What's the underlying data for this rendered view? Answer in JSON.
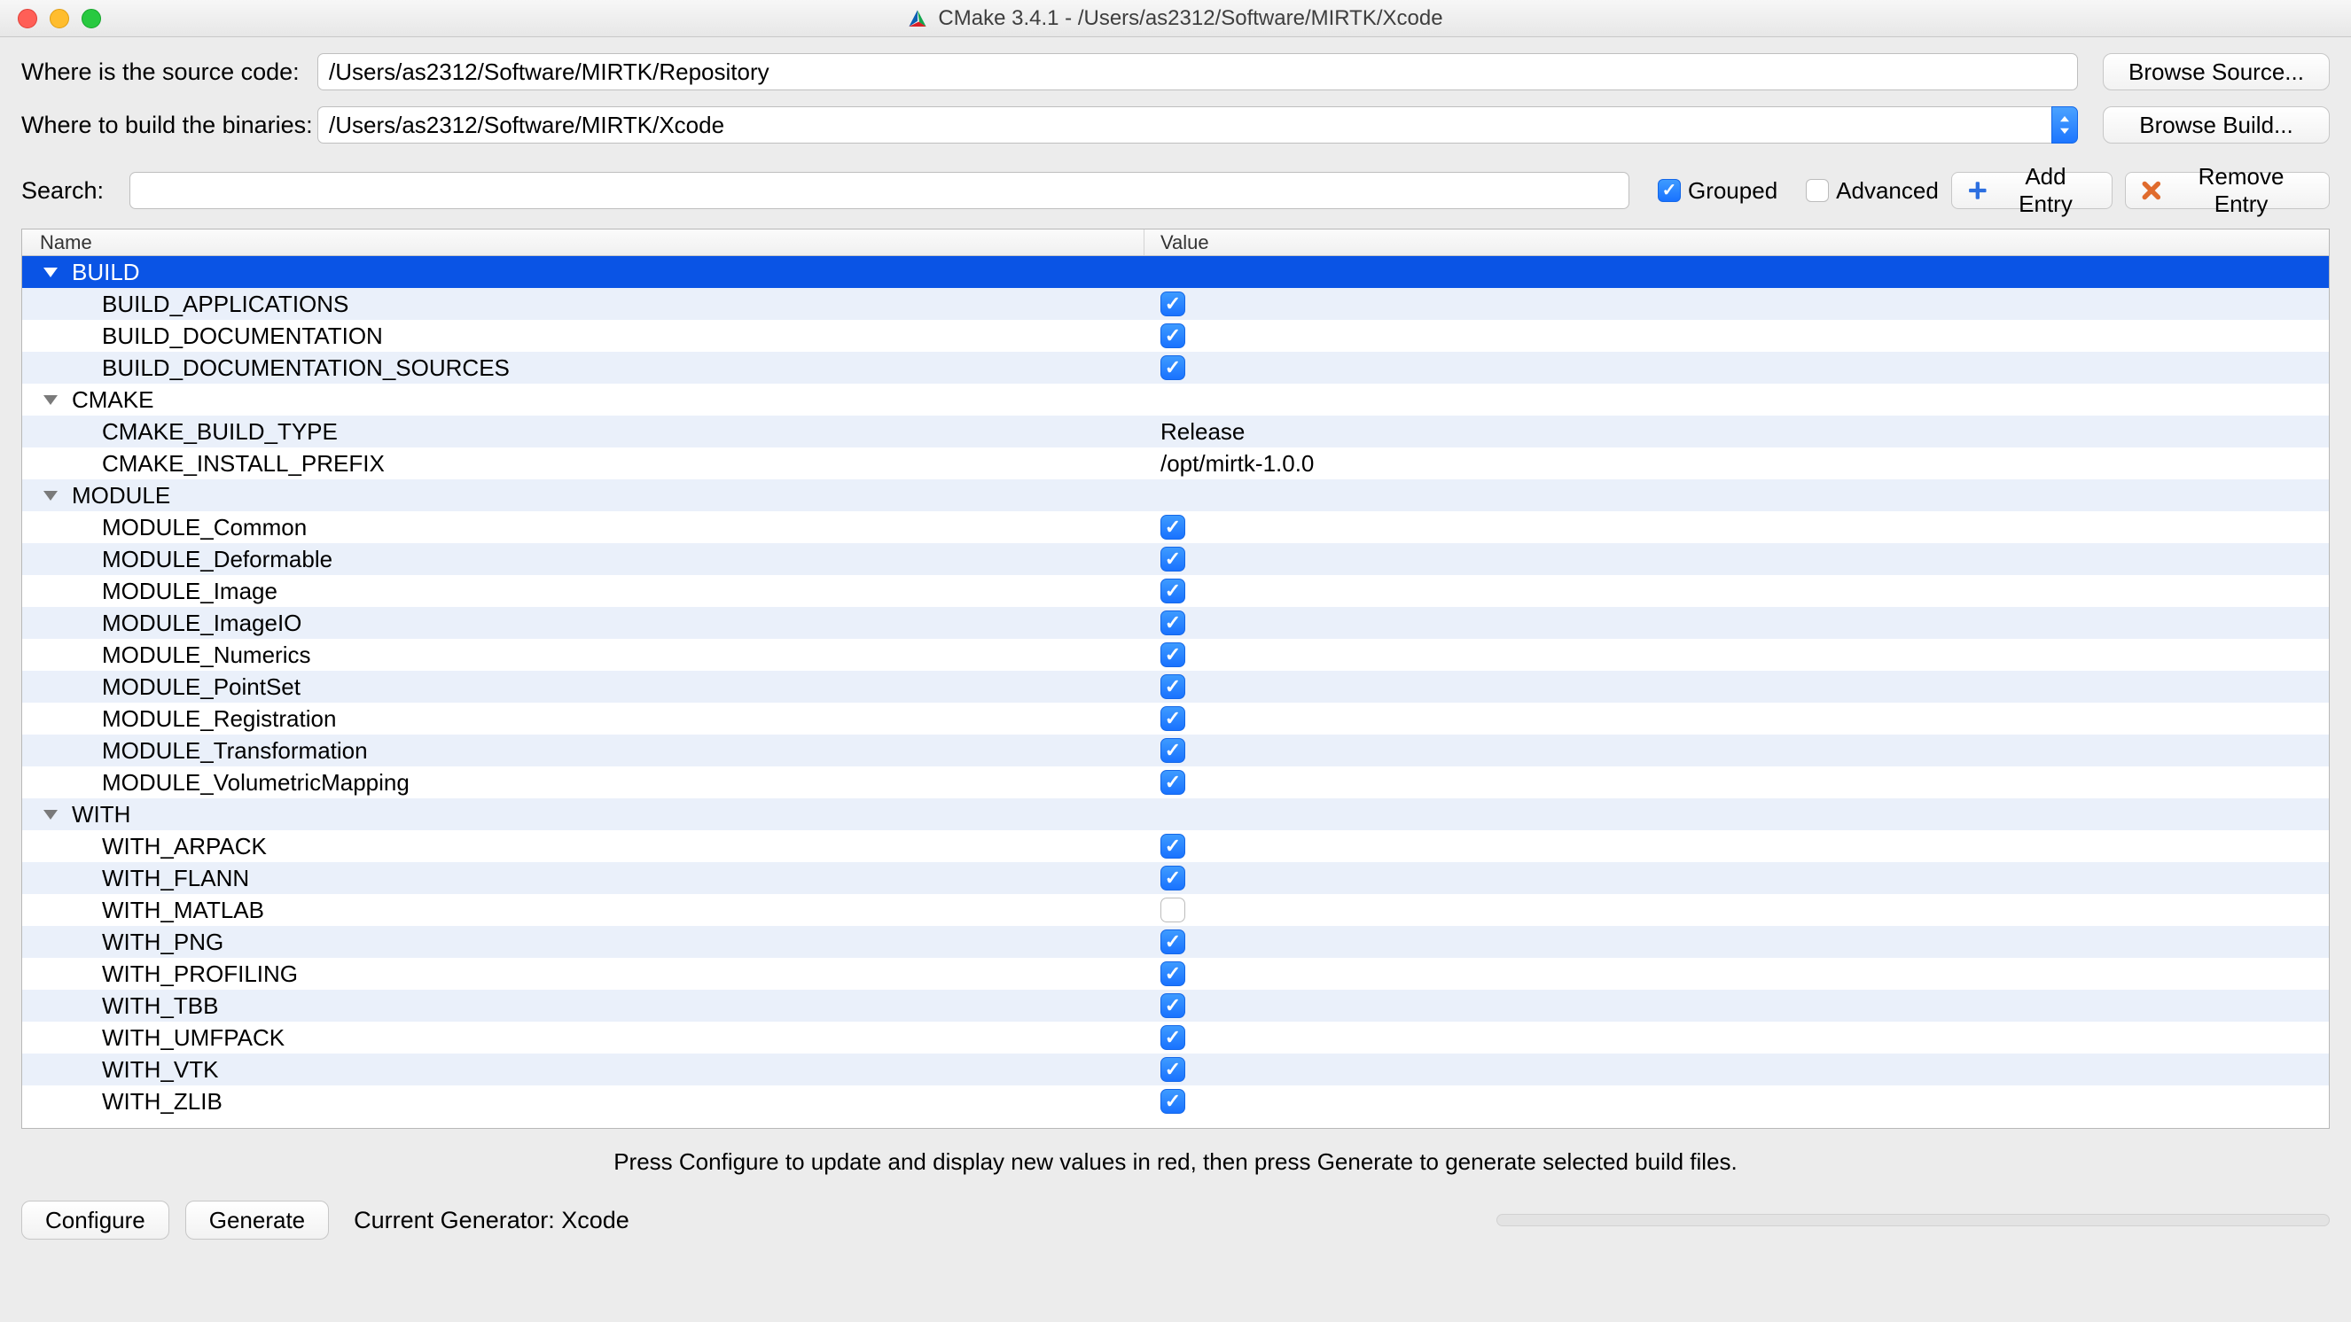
{
  "window": {
    "title": "CMake 3.4.1 - /Users/as2312/Software/MIRTK/Xcode"
  },
  "paths": {
    "source_label": "Where is the source code:",
    "source_value": "/Users/as2312/Software/MIRTK/Repository",
    "browse_source_label": "Browse Source...",
    "build_label": "Where to build the binaries:",
    "build_value": "/Users/as2312/Software/MIRTK/Xcode",
    "browse_build_label": "Browse Build..."
  },
  "search": {
    "label": "Search:",
    "value": "",
    "grouped_label": "Grouped",
    "grouped_checked": true,
    "advanced_label": "Advanced",
    "advanced_checked": false,
    "add_entry_label": "Add Entry",
    "remove_entry_label": "Remove Entry"
  },
  "table": {
    "header_name": "Name",
    "header_value": "Value",
    "groups": [
      {
        "name": "BUILD",
        "selected": true,
        "rows": [
          {
            "name": "BUILD_APPLICATIONS",
            "type": "bool",
            "value": true
          },
          {
            "name": "BUILD_DOCUMENTATION",
            "type": "bool",
            "value": true
          },
          {
            "name": "BUILD_DOCUMENTATION_SOURCES",
            "type": "bool",
            "value": true
          }
        ]
      },
      {
        "name": "CMAKE",
        "selected": false,
        "rows": [
          {
            "name": "CMAKE_BUILD_TYPE",
            "type": "text",
            "value": "Release"
          },
          {
            "name": "CMAKE_INSTALL_PREFIX",
            "type": "text",
            "value": "/opt/mirtk-1.0.0"
          }
        ]
      },
      {
        "name": "MODULE",
        "selected": false,
        "rows": [
          {
            "name": "MODULE_Common",
            "type": "bool",
            "value": true
          },
          {
            "name": "MODULE_Deformable",
            "type": "bool",
            "value": true
          },
          {
            "name": "MODULE_Image",
            "type": "bool",
            "value": true
          },
          {
            "name": "MODULE_ImageIO",
            "type": "bool",
            "value": true
          },
          {
            "name": "MODULE_Numerics",
            "type": "bool",
            "value": true
          },
          {
            "name": "MODULE_PointSet",
            "type": "bool",
            "value": true
          },
          {
            "name": "MODULE_Registration",
            "type": "bool",
            "value": true
          },
          {
            "name": "MODULE_Transformation",
            "type": "bool",
            "value": true
          },
          {
            "name": "MODULE_VolumetricMapping",
            "type": "bool",
            "value": true
          }
        ]
      },
      {
        "name": "WITH",
        "selected": false,
        "rows": [
          {
            "name": "WITH_ARPACK",
            "type": "bool",
            "value": true
          },
          {
            "name": "WITH_FLANN",
            "type": "bool",
            "value": true
          },
          {
            "name": "WITH_MATLAB",
            "type": "bool",
            "value": false
          },
          {
            "name": "WITH_PNG",
            "type": "bool",
            "value": true
          },
          {
            "name": "WITH_PROFILING",
            "type": "bool",
            "value": true
          },
          {
            "name": "WITH_TBB",
            "type": "bool",
            "value": true
          },
          {
            "name": "WITH_UMFPACK",
            "type": "bool",
            "value": true
          },
          {
            "name": "WITH_VTK",
            "type": "bool",
            "value": true
          },
          {
            "name": "WITH_ZLIB",
            "type": "bool",
            "value": true
          }
        ]
      }
    ]
  },
  "hint": "Press Configure to update and display new values in red, then press Generate to generate selected build files.",
  "footer": {
    "configure_label": "Configure",
    "generate_label": "Generate",
    "current_generator_label": "Current Generator: Xcode"
  }
}
